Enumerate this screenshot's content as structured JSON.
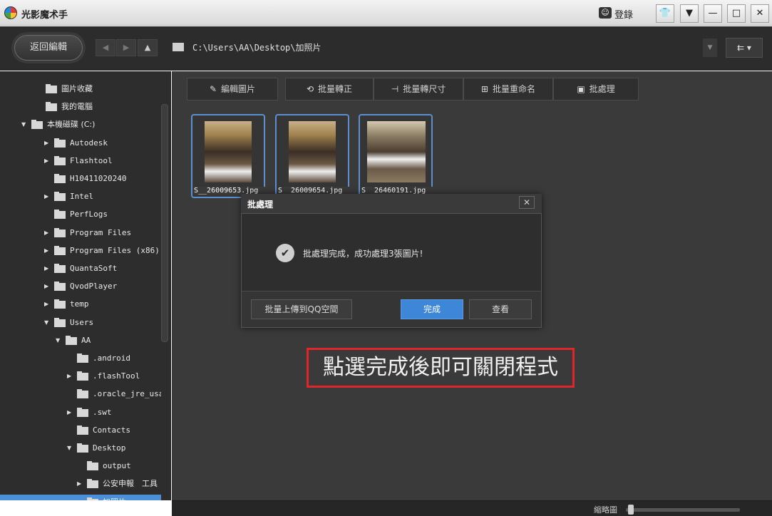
{
  "app": {
    "title": "光影魔术手",
    "login_label": "登錄"
  },
  "window_controls": {
    "skin": "👕",
    "menu": "▼",
    "minimize": "—",
    "maximize": "□",
    "close": "✕"
  },
  "toolbar": {
    "back_edit_label": "返回編輯",
    "nav_back": "◀",
    "nav_forward": "▶",
    "nav_up": "▲",
    "path": "C:\\Users\\AA\\Desktop\\加照片",
    "path_dropdown": "▼",
    "sort_label": "⇇ ▾"
  },
  "sidebar": {
    "items": [
      {
        "label": "圖片收藏",
        "depth": 0,
        "arrow": ""
      },
      {
        "label": "我的電腦",
        "depth": 0,
        "arrow": ""
      },
      {
        "label": "本機磁碟 (C:)",
        "depth": 1,
        "arrow": "▼"
      },
      {
        "label": "Autodesk",
        "depth": 2,
        "arrow": "▶"
      },
      {
        "label": "Flashtool",
        "depth": 2,
        "arrow": "▶"
      },
      {
        "label": "H10411020240",
        "depth": 2,
        "arrow": ""
      },
      {
        "label": "Intel",
        "depth": 2,
        "arrow": "▶"
      },
      {
        "label": "PerfLogs",
        "depth": 2,
        "arrow": ""
      },
      {
        "label": "Program Files",
        "depth": 2,
        "arrow": "▶"
      },
      {
        "label": "Program Files (x86)",
        "depth": 2,
        "arrow": "▶"
      },
      {
        "label": "QuantaSoft",
        "depth": 2,
        "arrow": "▶"
      },
      {
        "label": "QvodPlayer",
        "depth": 2,
        "arrow": "▶"
      },
      {
        "label": "temp",
        "depth": 2,
        "arrow": "▶"
      },
      {
        "label": "Users",
        "depth": 2,
        "arrow": "▼"
      },
      {
        "label": "AA",
        "depth": 3,
        "arrow": "▼"
      },
      {
        "label": ".android",
        "depth": 4,
        "arrow": ""
      },
      {
        "label": ".flashTool",
        "depth": 4,
        "arrow": "▶"
      },
      {
        "label": ".oracle_jre_usage",
        "depth": 4,
        "arrow": ""
      },
      {
        "label": ".swt",
        "depth": 4,
        "arrow": "▶"
      },
      {
        "label": "Contacts",
        "depth": 4,
        "arrow": ""
      },
      {
        "label": "Desktop",
        "depth": 4,
        "arrow": "▼"
      },
      {
        "label": "output",
        "depth": 5,
        "arrow": ""
      },
      {
        "label": "公安申報　工具",
        "depth": 5,
        "arrow": "▶"
      },
      {
        "label": "加照片",
        "depth": 5,
        "arrow": "",
        "selected": true
      }
    ]
  },
  "actions": [
    {
      "icon": "✎",
      "label": "編輯圖片"
    },
    {
      "icon": "⟲",
      "label": "批量轉正"
    },
    {
      "icon": "⊣",
      "label": "批量轉尺寸"
    },
    {
      "icon": "⊞",
      "label": "批量重命名"
    },
    {
      "icon": "▣",
      "label": "批處理"
    }
  ],
  "thumbnails": [
    {
      "name": "S__26009653.jpg"
    },
    {
      "name": "S__26009654.jpg"
    },
    {
      "name": "S__26460191.jpg"
    }
  ],
  "dialog": {
    "title": "批處理",
    "close": "✕",
    "message": "批處理完成，成功處理3張圖片!",
    "check_icon": "✔",
    "upload_label": "批量上傳到QQ空間",
    "done_label": "完成",
    "view_label": "查看"
  },
  "annotation": {
    "text": "點選完成後即可關閉程式"
  },
  "status": {
    "zoom_label": "縮略圖",
    "zoom_level": 0.02
  },
  "colors": {
    "accent": "#3d86d8",
    "annotation_border": "#e0252b",
    "panel": "#2d2d2d"
  }
}
